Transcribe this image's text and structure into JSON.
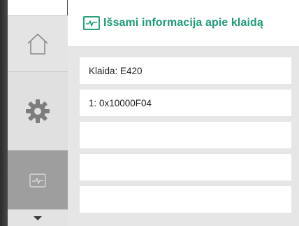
{
  "header": {
    "title": "Išsami informacija apie klaidą",
    "icon": "pulse-monitor-icon"
  },
  "sidebar": {
    "items": [
      {
        "icon": "home-icon",
        "active": false
      },
      {
        "icon": "gear-icon",
        "active": false
      },
      {
        "icon": "pulse-monitor-icon",
        "active": true
      }
    ],
    "scroll_indicator": "chevron-down-icon"
  },
  "details": {
    "rows": [
      {
        "text": "Klaida: E420"
      },
      {
        "text": "1: 0x10000F04"
      },
      {
        "text": ""
      },
      {
        "text": ""
      },
      {
        "text": ""
      }
    ]
  },
  "colors": {
    "accent": "#1f9a78",
    "sidebar_bg": "#e3e3e3",
    "sidebar_active_bg": "#9e9e9e",
    "list_bg": "#e6e6e6"
  }
}
